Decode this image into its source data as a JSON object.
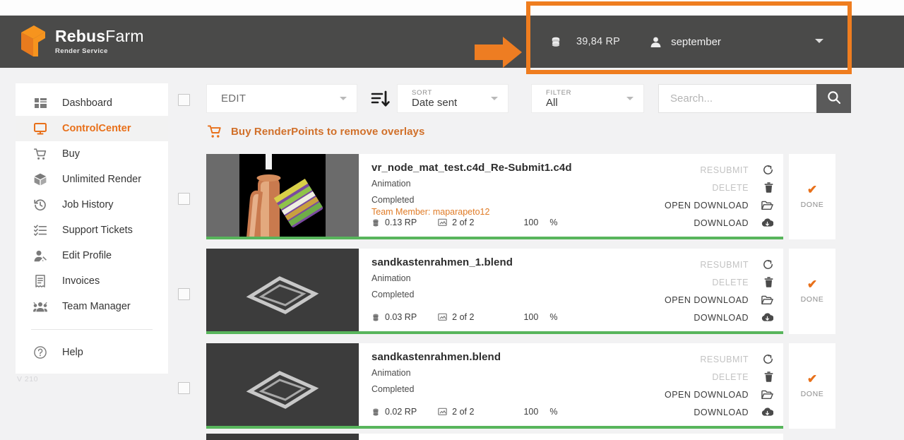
{
  "brand": {
    "name_bold": "Rebus",
    "name_light": "Farm",
    "tagline": "Render Service"
  },
  "header": {
    "render_points": "39,84 RP",
    "user_name": "september",
    "coins_icon": "coins-icon",
    "user_icon": "user-icon",
    "caret_icon": "chevron-down-icon",
    "arrow_icon": "arrow-right-icon",
    "highlight_color": "#ef7d1f",
    "bar_color": "#4a4a49"
  },
  "sidebar": {
    "version": "V 210",
    "items": [
      {
        "label": "Dashboard",
        "icon": "dashboard-icon",
        "active": false
      },
      {
        "label": "ControlCenter",
        "icon": "monitor-icon",
        "active": true
      },
      {
        "label": "Buy",
        "icon": "cart-icon",
        "active": false
      },
      {
        "label": "Unlimited Render",
        "icon": "box-icon",
        "active": false
      },
      {
        "label": "Job History",
        "icon": "history-icon",
        "active": false
      },
      {
        "label": "Support Tickets",
        "icon": "list-checks-icon",
        "active": false
      },
      {
        "label": "Edit Profile",
        "icon": "user-edit-icon",
        "active": false
      },
      {
        "label": "Invoices",
        "icon": "invoice-icon",
        "active": false
      },
      {
        "label": "Team Manager",
        "icon": "team-icon",
        "active": false
      }
    ],
    "help": {
      "label": "Help",
      "icon": "help-circle-icon"
    }
  },
  "toolbar": {
    "edit": {
      "value": "EDIT",
      "caret_icon": "chevron-down-icon"
    },
    "sort_icon": "sort-descending-icon",
    "sort": {
      "caption": "SORT",
      "value": "Date sent",
      "caret_icon": "chevron-down-icon"
    },
    "filter": {
      "caption": "FILTER",
      "value": "All",
      "caret_icon": "chevron-down-icon"
    },
    "search": {
      "placeholder": "Search...",
      "value": "",
      "button_icon": "search-icon"
    }
  },
  "banner": {
    "icon": "cart-icon",
    "text": "Buy RenderPoints to remove overlays",
    "color": "#d1702a"
  },
  "jobs": {
    "action_labels": {
      "resubmit": "RESUBMIT",
      "delete": "DELETE",
      "open_download": "OPEN DOWNLOAD",
      "download": "DOWNLOAD"
    },
    "action_icons": {
      "resubmit": "refresh-icon",
      "delete": "trash-icon",
      "open_download": "folder-open-icon",
      "download": "cloud-download-icon"
    },
    "stat_icons": {
      "points": "coins-icon",
      "frames": "image-icon"
    },
    "status_icon": "check-icon",
    "progress_unit": "%",
    "items": [
      {
        "title": "vr_node_mat_test.c4d_Re-Submit1.c4d",
        "type": "Animation",
        "state": "Completed",
        "team_member": "Team Member: maparapeto12",
        "points": "0.13 RP",
        "frames": "2 of 2",
        "progress": "100",
        "status": "DONE",
        "thumb": "c4d-render-copper-pipes"
      },
      {
        "title": "sandkastenrahmen_1.blend",
        "type": "Animation",
        "state": "Completed",
        "team_member": "",
        "points": "0.03 RP",
        "frames": "2 of 2",
        "progress": "100",
        "status": "DONE",
        "thumb": "blend-render-frame"
      },
      {
        "title": "sandkastenrahmen.blend",
        "type": "Animation",
        "state": "Completed",
        "team_member": "",
        "points": "0.02 RP",
        "frames": "2 of 2",
        "progress": "100",
        "status": "DONE",
        "thumb": "blend-render-frame"
      }
    ]
  },
  "checkboxes": {
    "count": 4,
    "checked": false
  }
}
